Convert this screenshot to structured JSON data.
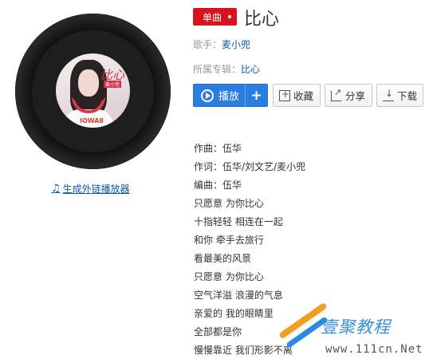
{
  "album": {
    "cover_title": "比心",
    "cover_subtitle": "麦小兜",
    "cover_bottom": "IOWA8",
    "generate_link": "生成外链播放器"
  },
  "song": {
    "tag": "单曲",
    "title": "比心",
    "singer_label": "歌手：",
    "singer": "麦小兜",
    "album_label": "所属专辑：",
    "album": "比心"
  },
  "actions": {
    "play": "播放",
    "add": "+",
    "favorite": "收藏",
    "share": "分享",
    "download": "下载"
  },
  "lyrics": [
    "作曲：伍华",
    "作词：伍华/刘文艺/麦小兜",
    "编曲：伍华",
    "只愿意 为你比心",
    "十指轻轻 相连在一起",
    "和你 牵手去旅行",
    "看最美的风景",
    "只愿意 为你比心",
    "空气洋溢 浪漫的气息",
    "亲爱的 我的眼睛里",
    "全部都是你",
    "慢慢靠近 我们形影不离"
  ],
  "watermark": {
    "name": "壹聚教程",
    "url": "www.111cn.Net"
  },
  "colors": {
    "tag_red": "#d7141e",
    "play_blue": "#2b7de1",
    "link_blue": "#0c5aa6"
  }
}
